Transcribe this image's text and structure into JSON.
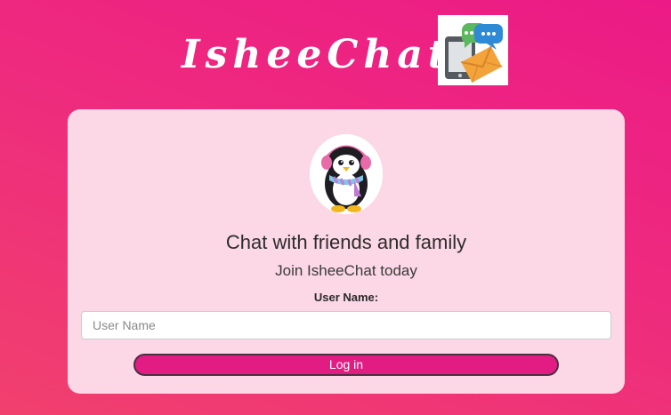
{
  "header": {
    "title": "IsheeChat",
    "logo_icon": "chat-envelope-phone-icon"
  },
  "card": {
    "avatar_icon": "penguin-avatar-icon",
    "headline": "Chat with friends and family",
    "subline": "Join IsheeChat today",
    "username_label": "User Name:",
    "username_placeholder": "User Name",
    "username_value": "",
    "login_label": "Log in"
  },
  "colors": {
    "background_top": "#ec1a86",
    "background_bottom": "#f1406e",
    "card": "#fcd7e5",
    "button": "#e31c84",
    "text": "#2c2c2c"
  }
}
